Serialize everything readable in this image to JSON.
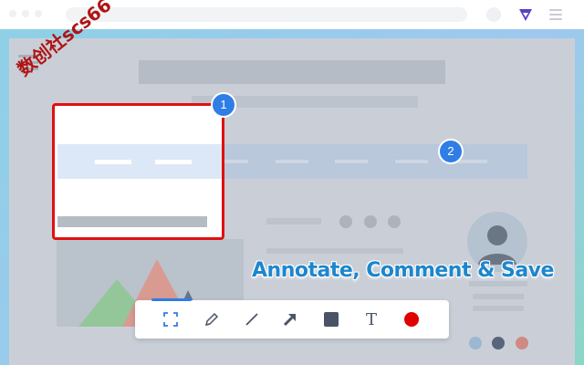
{
  "browser": {
    "extension_icon": "triangle-logo-icon",
    "menu_icon": "hamburger-menu-icon"
  },
  "watermark": {
    "text": "数创社scs66"
  },
  "badges": [
    {
      "number": "1"
    },
    {
      "number": "2"
    }
  ],
  "tagline": {
    "text": "Annotate, Comment & Save"
  },
  "toolbar": {
    "tools": [
      {
        "name": "select-area",
        "icon": "crop-select-icon",
        "active": true
      },
      {
        "name": "pen",
        "icon": "pen-icon"
      },
      {
        "name": "line",
        "icon": "line-icon"
      },
      {
        "name": "arrow",
        "icon": "arrow-icon"
      },
      {
        "name": "rectangle",
        "icon": "square-icon"
      },
      {
        "name": "text",
        "icon": "text-icon",
        "glyph": "T"
      },
      {
        "name": "color",
        "icon": "color-dot-icon",
        "color": "#e00000"
      }
    ]
  },
  "colors": {
    "accent": "#2f7de6",
    "selection": "#e01010",
    "tagline": "#1e86cc",
    "extension": "#5b3ec8"
  }
}
